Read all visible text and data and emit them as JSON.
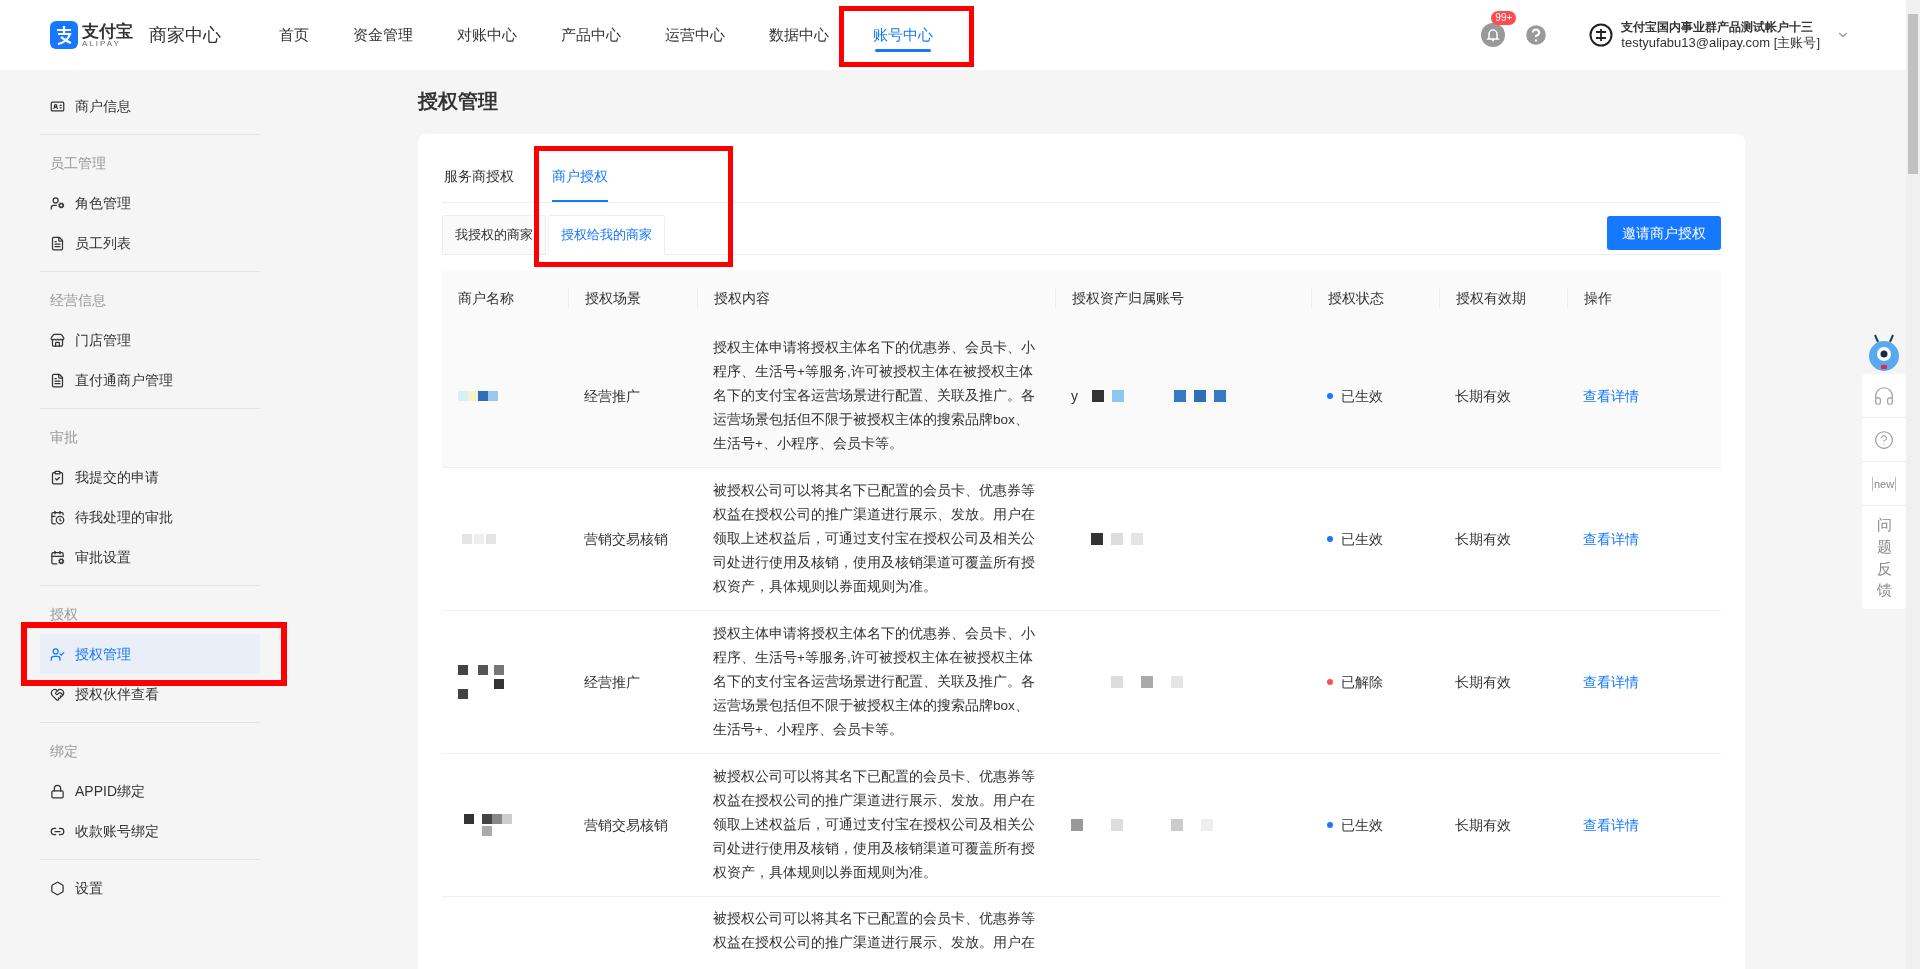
{
  "header": {
    "logo_text": "支付宝",
    "logo_sub": "ALIPAY",
    "app_title": "商家中心",
    "nav": [
      {
        "label": "首页",
        "selected": false
      },
      {
        "label": "资金管理",
        "selected": false
      },
      {
        "label": "对账中心",
        "selected": false
      },
      {
        "label": "产品中心",
        "selected": false
      },
      {
        "label": "运营中心",
        "selected": false
      },
      {
        "label": "数据中心",
        "selected": false
      },
      {
        "label": "账号中心",
        "selected": true
      }
    ],
    "notification_badge": "99+",
    "account": {
      "name": "支付宝国内事业群产品测试帐户十三",
      "email": "testyufabu13@alipay.com [主账号]"
    }
  },
  "sidebar": {
    "sections": [
      {
        "items": [
          {
            "label": "商户信息",
            "selected": false
          }
        ]
      },
      {
        "title": "员工管理",
        "items": [
          {
            "label": "角色管理",
            "selected": false
          },
          {
            "label": "员工列表",
            "selected": false
          }
        ]
      },
      {
        "title": "经营信息",
        "items": [
          {
            "label": "门店管理",
            "selected": false
          },
          {
            "label": "直付通商户管理",
            "selected": false
          }
        ]
      },
      {
        "title": "审批",
        "items": [
          {
            "label": "我提交的申请",
            "selected": false
          },
          {
            "label": "待我处理的审批",
            "selected": false
          },
          {
            "label": "审批设置",
            "selected": false
          }
        ]
      },
      {
        "title": "授权",
        "items": [
          {
            "label": "授权管理",
            "selected": true
          },
          {
            "label": "授权伙伴查看",
            "selected": false
          }
        ]
      },
      {
        "title": "绑定",
        "items": [
          {
            "label": "APPID绑定",
            "selected": false
          },
          {
            "label": "收款账号绑定",
            "selected": false
          }
        ]
      },
      {
        "items": [
          {
            "label": "设置",
            "selected": false
          }
        ]
      }
    ]
  },
  "page_title": "授权管理",
  "tabs": [
    {
      "label": "服务商授权",
      "selected": false
    },
    {
      "label": "商户授权",
      "selected": true
    }
  ],
  "sub_tabs": [
    {
      "label": "我授权的商家",
      "selected": false
    },
    {
      "label": "授权给我的商家",
      "selected": true
    }
  ],
  "invite_button": "邀请商户授权",
  "table": {
    "columns": [
      "商户名称",
      "授权场景",
      "授权内容",
      "授权资产归属账号",
      "授权状态",
      "授权有效期",
      "操作"
    ],
    "rows": [
      {
        "scene": "经营推广",
        "content": "授权主体申请将授权主体名下的优惠券、会员卡、小程序、生活号+等服务,许可被授权主体在被授权主体名下的支付宝各运营场景进行配置、关联及推广。各运营场景包括但不限于被授权主体的搜索品牌box、生活号+、小程序、会员卡等。",
        "account_visible": "y",
        "status": "已生效",
        "color": "#1677ff",
        "validity": "长期有效",
        "action": "查看详情"
      },
      {
        "scene": "营销交易核销",
        "content": "被授权公司可以将其名下已配置的会员卡、优惠券等权益在授权公司的推广渠道进行展示、发放。用户在领取上述权益后，可通过支付宝在授权公司及相关公司处进行使用及核销，使用及核销渠道可覆盖所有授权资产，具体规则以券面规则为准。",
        "status": "已生效",
        "color": "#1677ff",
        "validity": "长期有效",
        "action": "查看详情"
      },
      {
        "scene": "经营推广",
        "content": "授权主体申请将授权主体名下的优惠券、会员卡、小程序、生活号+等服务,许可被授权主体在被授权主体名下的支付宝各运营场景进行配置、关联及推广。各运营场景包括但不限于被授权主体的搜索品牌box、生活号+、小程序、会员卡等。",
        "status": "已解除",
        "color": "#ff4d4f",
        "validity": "长期有效",
        "action": "查看详情"
      },
      {
        "scene": "营销交易核销",
        "content": "被授权公司可以将其名下已配置的会员卡、优惠券等权益在授权公司的推广渠道进行展示、发放。用户在领取上述权益后，可通过支付宝在授权公司及相关公司处进行使用及核销，使用及核销渠道可覆盖所有授权资产，具体规则以券面规则为准。",
        "status": "已生效",
        "color": "#1677ff",
        "validity": "长期有效",
        "action": "查看详情"
      },
      {
        "content": "被授权公司可以将其名下已配置的会员卡、优惠券等权益在授权公司的推广渠道进行展示、发放。用户在"
      }
    ]
  },
  "feedback": {
    "new_label": "new",
    "label": "问题反馈"
  }
}
